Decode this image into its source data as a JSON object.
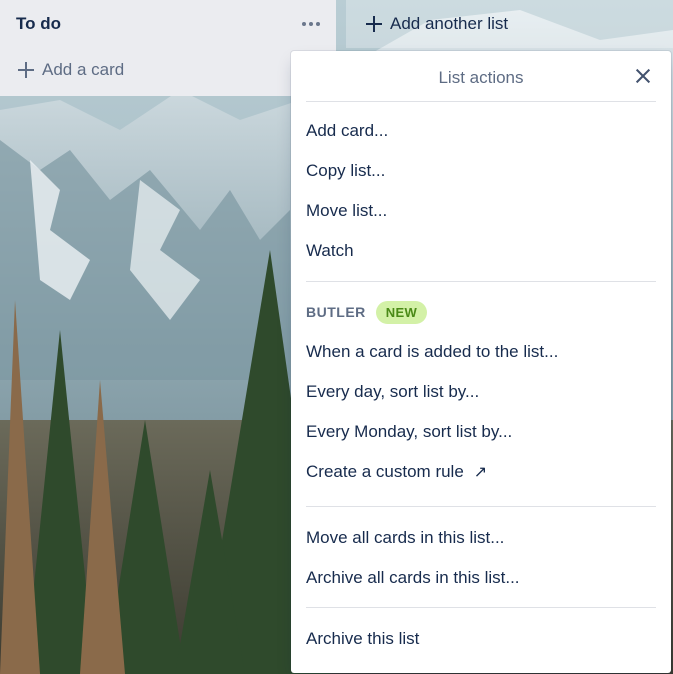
{
  "list": {
    "title": "To do",
    "add_card_label": "Add a card"
  },
  "add_list": {
    "label": "Add another list"
  },
  "popover": {
    "title": "List actions",
    "items_main": [
      {
        "label": "Add card..."
      },
      {
        "label": "Copy list..."
      },
      {
        "label": "Move list..."
      },
      {
        "label": "Watch"
      }
    ],
    "butler": {
      "label": "BUTLER",
      "badge": "NEW",
      "items": [
        {
          "label": "When a card is added to the list..."
        },
        {
          "label": "Every day, sort list by..."
        },
        {
          "label": "Every Monday, sort list by..."
        },
        {
          "label": "Create a custom rule"
        }
      ]
    },
    "items_bulk": [
      {
        "label": "Move all cards in this list..."
      },
      {
        "label": "Archive all cards in this list..."
      }
    ],
    "archive_list_label": "Archive this list"
  },
  "colors": {
    "list_bg": "#ebecf0",
    "badge_bg": "#d3f1a7",
    "badge_text": "#4a8a17",
    "text": "#172b4d"
  }
}
